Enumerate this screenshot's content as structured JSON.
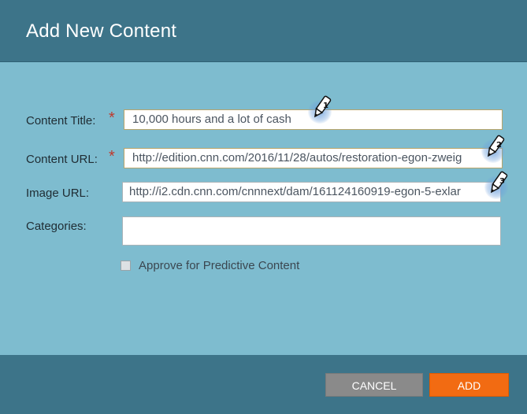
{
  "dialog": {
    "title": "Add New Content"
  },
  "form": {
    "content_title": {
      "label": "Content Title:",
      "required": "*",
      "value": "10,000 hours and a lot of cash"
    },
    "content_url": {
      "label": "Content URL:",
      "required": "*",
      "value": "http://edition.cnn.com/2016/11/28/autos/restoration-egon-zweig"
    },
    "image_url": {
      "label": "Image URL:",
      "value": "http://i2.cdn.cnn.com/cnnnext/dam/161124160919-egon-5-exlar"
    },
    "categories": {
      "label": "Categories:",
      "value": ""
    },
    "approve_checkbox": {
      "label": "Approve for Predictive Content",
      "checked": false
    }
  },
  "footer": {
    "cancel_label": "CANCEL",
    "add_label": "ADD"
  },
  "markers": [
    "1",
    "2",
    "3"
  ],
  "colors": {
    "header": "#3d7489",
    "body": "#7ebccf",
    "add_button": "#f26b12",
    "cancel_button": "#8a8a8a",
    "required": "#c0392b"
  }
}
